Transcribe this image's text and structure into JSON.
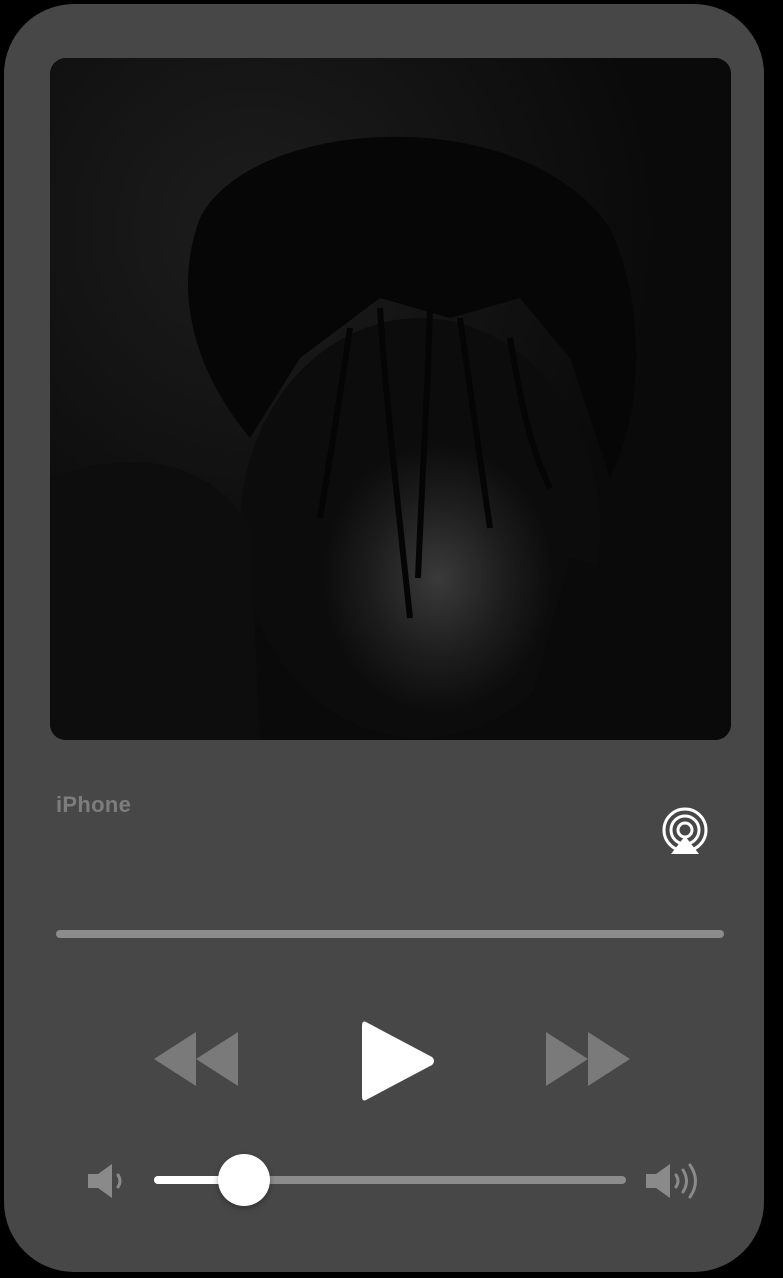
{
  "player": {
    "device_label": "iPhone",
    "progress_fraction": 0,
    "volume_fraction": 0.19
  },
  "icons": {
    "airplay": "airplay-icon",
    "rewind": "rewind-icon",
    "play": "play-icon",
    "forward": "fast-forward-icon",
    "volume_low": "speaker-low-icon",
    "volume_high": "speaker-high-icon"
  },
  "colors": {
    "card_background": "#474747",
    "page_background": "#000000",
    "label_text": "#7d7d7d",
    "track": "#8c8c8c",
    "volume_fill": "#ffffff",
    "controls": "#ffffff",
    "dim_controls": "#7a7a7a"
  }
}
